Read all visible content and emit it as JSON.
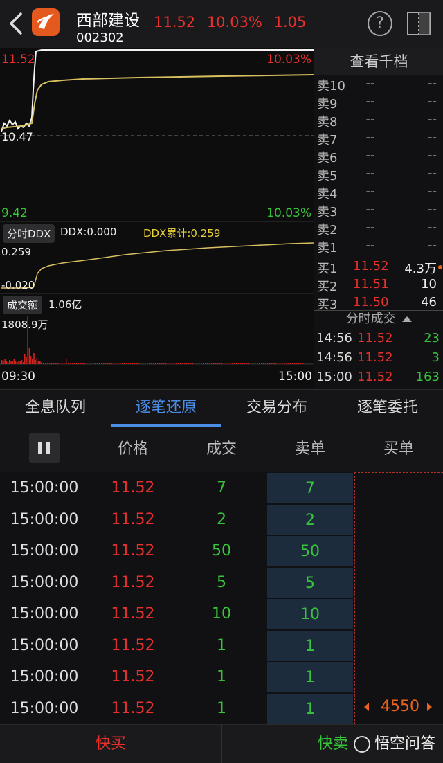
{
  "header": {
    "stock_name": "西部建设",
    "stock_code": "002302",
    "price": "11.52",
    "change_pct": "10.03%",
    "change_amt": "1.05",
    "help_label": "?"
  },
  "chart": {
    "price_high": "11.52",
    "pct_high": "10.03%",
    "price_mid": "10.47",
    "price_low": "9.42",
    "pct_low": "10.03%",
    "ddx_tag": "分时DDX",
    "ddx_value": "DDX:0.000",
    "ddx_cum": "DDX累计:0.259",
    "ddx_top": "0.259",
    "ddx_bottom": "-0.020",
    "amount_tag": "成交额",
    "amount_value": "1.06亿",
    "amount_max": "1808.9万",
    "time_start": "09:30",
    "time_end": "15:00"
  },
  "order_book": {
    "title": "查看千档",
    "asks": [
      {
        "label": "卖10",
        "price": "--",
        "volume": "--"
      },
      {
        "label": "卖9",
        "price": "--",
        "volume": "--"
      },
      {
        "label": "卖8",
        "price": "--",
        "volume": "--"
      },
      {
        "label": "卖7",
        "price": "--",
        "volume": "--"
      },
      {
        "label": "卖6",
        "price": "--",
        "volume": "--"
      },
      {
        "label": "卖5",
        "price": "--",
        "volume": "--"
      },
      {
        "label": "卖4",
        "price": "--",
        "volume": "--"
      },
      {
        "label": "卖3",
        "price": "--",
        "volume": "--"
      },
      {
        "label": "卖2",
        "price": "--",
        "volume": "--"
      },
      {
        "label": "卖1",
        "price": "--",
        "volume": "--"
      }
    ],
    "bids": [
      {
        "label": "买1",
        "price": "11.52",
        "volume": "4.3万"
      },
      {
        "label": "买2",
        "price": "11.51",
        "volume": "10"
      },
      {
        "label": "买3",
        "price": "11.50",
        "volume": "46"
      }
    ],
    "trades_title": "分时成交",
    "trades": [
      {
        "time": "14:56",
        "price": "11.52",
        "volume": "23"
      },
      {
        "time": "14:56",
        "price": "11.52",
        "volume": "3"
      },
      {
        "time": "15:00",
        "price": "11.52",
        "volume": "163"
      }
    ]
  },
  "tabs": [
    {
      "label": "全息队列"
    },
    {
      "label": "逐笔还原"
    },
    {
      "label": "交易分布"
    },
    {
      "label": "逐笔委托"
    }
  ],
  "table": {
    "headers": {
      "price": "价格",
      "volume": "成交",
      "sell": "卖单",
      "buy": "买单"
    },
    "rows": [
      {
        "time": "15:00:00",
        "price": "11.52",
        "volume": "7",
        "sell": "7"
      },
      {
        "time": "15:00:00",
        "price": "11.52",
        "volume": "2",
        "sell": "2"
      },
      {
        "time": "15:00:00",
        "price": "11.52",
        "volume": "50",
        "sell": "50"
      },
      {
        "time": "15:00:00",
        "price": "11.52",
        "volume": "5",
        "sell": "5"
      },
      {
        "time": "15:00:00",
        "price": "11.52",
        "volume": "10",
        "sell": "10"
      },
      {
        "time": "15:00:00",
        "price": "11.52",
        "volume": "1",
        "sell": "1"
      },
      {
        "time": "15:00:00",
        "price": "11.52",
        "volume": "1",
        "sell": "1"
      },
      {
        "time": "15:00:00",
        "price": "11.52",
        "volume": "1",
        "sell": "1"
      }
    ],
    "buy_order_value": "4550"
  },
  "bottom": {
    "quick_buy": "快买",
    "quick_sell": "快卖",
    "watermark": "悟空问答"
  },
  "colors": {
    "up": "#e8302c",
    "down": "#37c33a",
    "accent": "#4a8ee8",
    "avg_line": "#d8c060"
  }
}
